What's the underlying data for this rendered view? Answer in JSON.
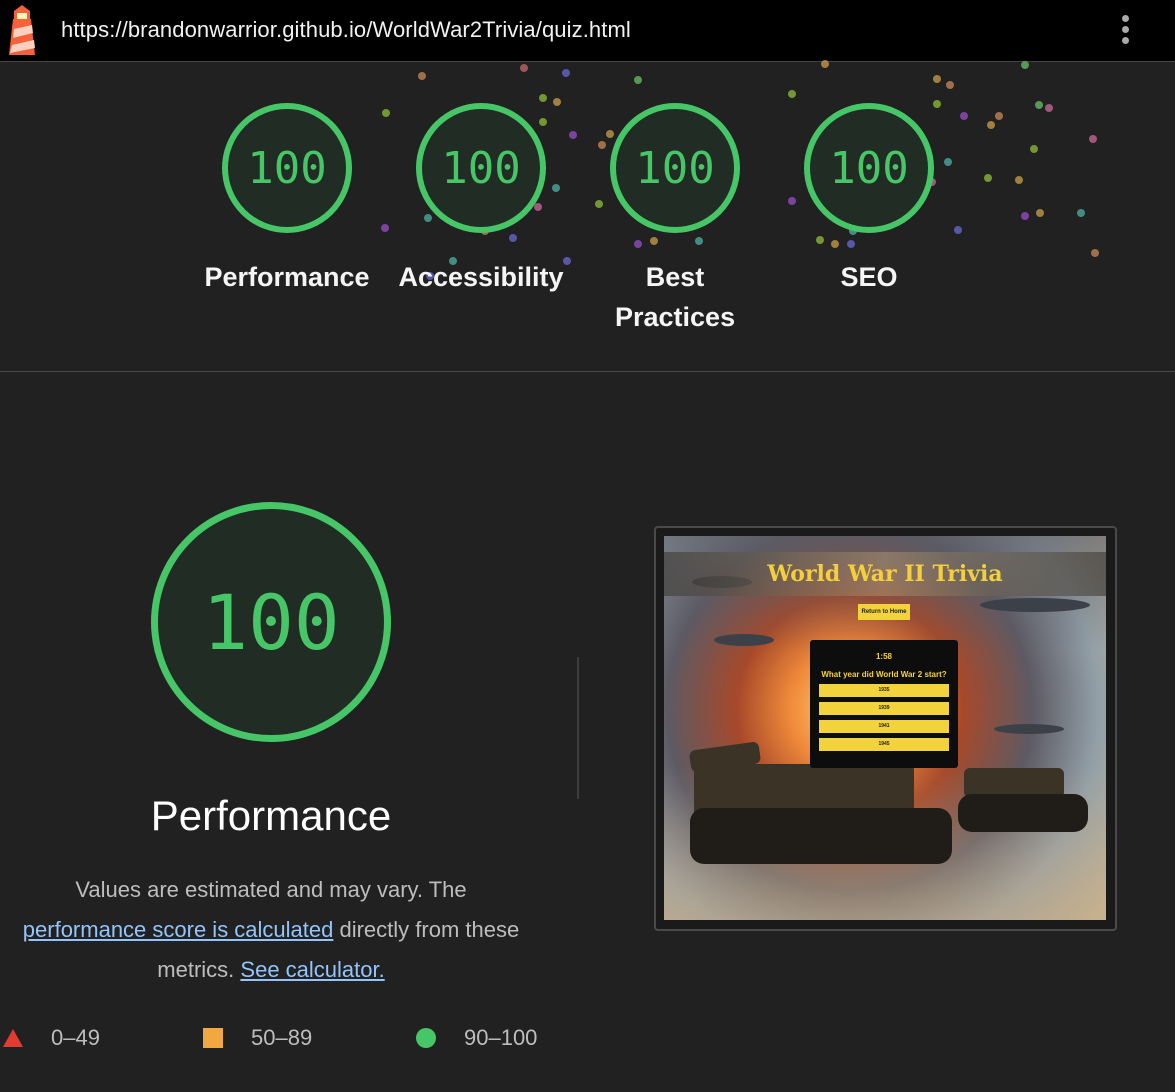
{
  "browser": {
    "url": "https://brandonwarrior.github.io/WorldWar2Trivia/quiz.html",
    "logo_icon": "lighthouse-icon",
    "menu_icon": "kebab-menu-icon"
  },
  "colors": {
    "pass": "#46c667",
    "average": "#f2a840",
    "fail": "#e23b2f",
    "link": "#93c4fb"
  },
  "gauges": [
    {
      "score": "100",
      "label": "Performance"
    },
    {
      "score": "100",
      "label": "Accessibility"
    },
    {
      "score": "100",
      "label": "Best Practices"
    },
    {
      "score": "100",
      "label": "SEO"
    }
  ],
  "performance": {
    "score": "100",
    "title": "Performance",
    "desc_pre": "Values are estimated and may vary. The ",
    "desc_link1": "performance score is calculated",
    "desc_mid": " directly from these metrics. ",
    "desc_link2": "See calculator."
  },
  "legend": [
    {
      "range": "0–49",
      "shape": "triangle"
    },
    {
      "range": "50–89",
      "shape": "square"
    },
    {
      "range": "90–100",
      "shape": "circle"
    }
  ],
  "screenshot": {
    "site_title": "World War II Trivia",
    "home_button": "Return to Home",
    "timer": "1:58",
    "question": "What year did World War 2 start?",
    "options": [
      "1935",
      "1939",
      "1941",
      "1945"
    ]
  }
}
